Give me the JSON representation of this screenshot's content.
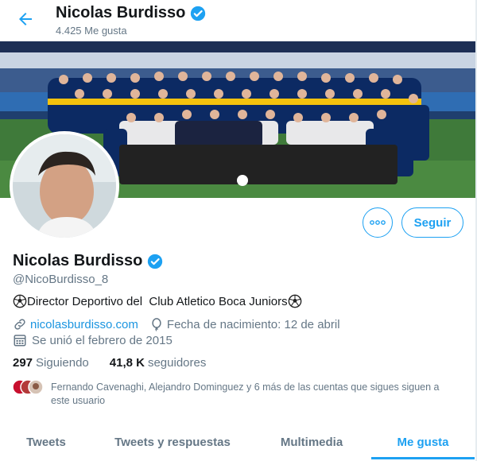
{
  "header": {
    "name": "Nicolas Burdisso",
    "likes_count": "4.425 Me gusta"
  },
  "profile": {
    "name": "Nicolas Burdisso",
    "handle": "@NicoBurdisso_8",
    "bio": "Director Deportivo del  Club Atletico Boca Juniors",
    "website": "nicolasburdisso.com",
    "birthday": "Fecha de nacimiento: 12 de abril",
    "joined": "Se unió el febrero de 2015",
    "following_count": "297",
    "following_label": "Siguiendo",
    "followers_count": "41,8 K",
    "followers_label": "seguidores",
    "followed_by_line1": "Fernando Cavenaghi, Alejandro Dominguez y 6 más de las cuentas que sigues siguen a",
    "followed_by_line2": "este usuario"
  },
  "actions": {
    "more_label": "°°°",
    "follow_label": "Seguir"
  },
  "tabs": [
    {
      "label": "Tweets",
      "active": false
    },
    {
      "label": "Tweets y respuestas",
      "active": false
    },
    {
      "label": "Multimedia",
      "active": false
    },
    {
      "label": "Me gusta",
      "active": true
    }
  ],
  "colors": {
    "accent": "#1da1f2",
    "secondary_text": "#657786",
    "banner_blue": "#0c2a63",
    "jersey_yellow": "#f4c20d"
  },
  "icons": [
    "back-arrow-icon",
    "verified-badge-icon",
    "more-options-icon",
    "soccer-ball-icon",
    "link-icon",
    "balloon-icon",
    "calendar-icon"
  ]
}
